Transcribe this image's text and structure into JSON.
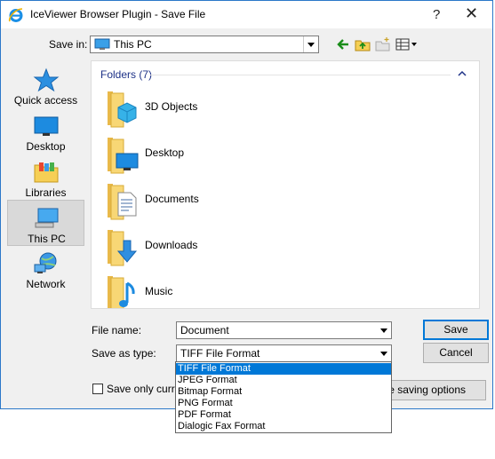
{
  "window": {
    "title": "IceViewer Browser Plugin - Save File",
    "help_glyph": "?",
    "close_glyph": "✕"
  },
  "save_in": {
    "label": "Save in:",
    "value": "This PC"
  },
  "places": [
    {
      "label": "Quick access",
      "icon": "star-icon"
    },
    {
      "label": "Desktop",
      "icon": "desktop-icon"
    },
    {
      "label": "Libraries",
      "icon": "libraries-icon"
    },
    {
      "label": "This PC",
      "icon": "computer-icon",
      "selected": true
    },
    {
      "label": "Network",
      "icon": "network-icon"
    }
  ],
  "file_list": {
    "group_header": "Folders (7)",
    "items": [
      {
        "name": "3D Objects",
        "icon": "3d-objects-folder-icon"
      },
      {
        "name": "Desktop",
        "icon": "desktop-folder-icon"
      },
      {
        "name": "Documents",
        "icon": "documents-folder-icon"
      },
      {
        "name": "Downloads",
        "icon": "downloads-folder-icon"
      },
      {
        "name": "Music",
        "icon": "music-folder-icon"
      }
    ]
  },
  "file_name": {
    "label": "File name:",
    "value": "Document"
  },
  "save_as_type": {
    "label": "Save as type:",
    "value": "TIFF File Format",
    "options": [
      "TIFF File Format",
      "JPEG Format",
      "Bitmap Format",
      "PNG Format",
      "PDF Format",
      "Dialogic Fax Format"
    ],
    "selected_index": 0
  },
  "buttons": {
    "save": "Save",
    "cancel": "Cancel",
    "saving_options": "e saving options"
  },
  "checkbox": {
    "label": "Save only curre"
  },
  "colors": {
    "accent": "#0078d7",
    "group_header": "#1e3287",
    "folder": "#f8d775"
  }
}
